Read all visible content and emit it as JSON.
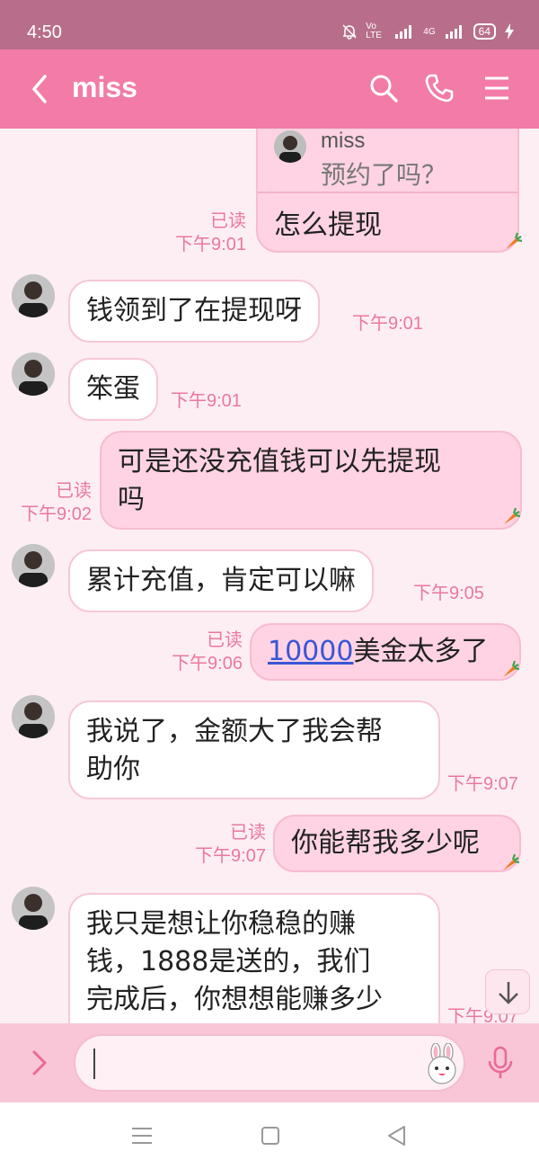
{
  "status": {
    "time": "4:50",
    "volte": "Vo LTE",
    "network": "4G",
    "battery": "64"
  },
  "header": {
    "title": "miss",
    "icons": [
      "back-icon",
      "search-icon",
      "phone-icon",
      "menu-icon"
    ]
  },
  "quoted": {
    "name": "miss",
    "text": "预约了吗？",
    "reply": "怎么提现",
    "status": "已读",
    "time": "下午9:01"
  },
  "messages": [
    {
      "dir": "in",
      "text": "钱领到了在提现呀",
      "time": "下午9:01"
    },
    {
      "dir": "in",
      "text": "笨蛋",
      "time": "下午9:01"
    },
    {
      "dir": "out",
      "line1": "可是还没充值钱可以先提现",
      "line2": "吗",
      "status": "已读",
      "time": "下午9:02"
    },
    {
      "dir": "in",
      "text": "累计充值，肯定可以嘛",
      "time": "下午9:05"
    },
    {
      "dir": "out",
      "link": "10000",
      "rest": "美金太多了",
      "status": "已读",
      "time": "下午9:06"
    },
    {
      "dir": "in",
      "line1": "我说了，金额大了我会帮",
      "line2": "助你",
      "time": "下午9:07"
    },
    {
      "dir": "out",
      "text": "你能帮我多少呢",
      "status": "已读",
      "time": "下午9:07"
    },
    {
      "dir": "in",
      "line1": "我只是想让你稳稳的赚",
      "line2": "钱，1888是送的，我们",
      "line3": "完成后，你想想能赚多少",
      "time": "下午9:07"
    }
  ],
  "colors": {
    "status_bar": "#b86e8a",
    "header": "#f27ba7",
    "background": "#fdeef3",
    "outgoing_bubble": "#ffd3e3",
    "meta_text": "#e978a1",
    "link": "#3a55d6"
  }
}
